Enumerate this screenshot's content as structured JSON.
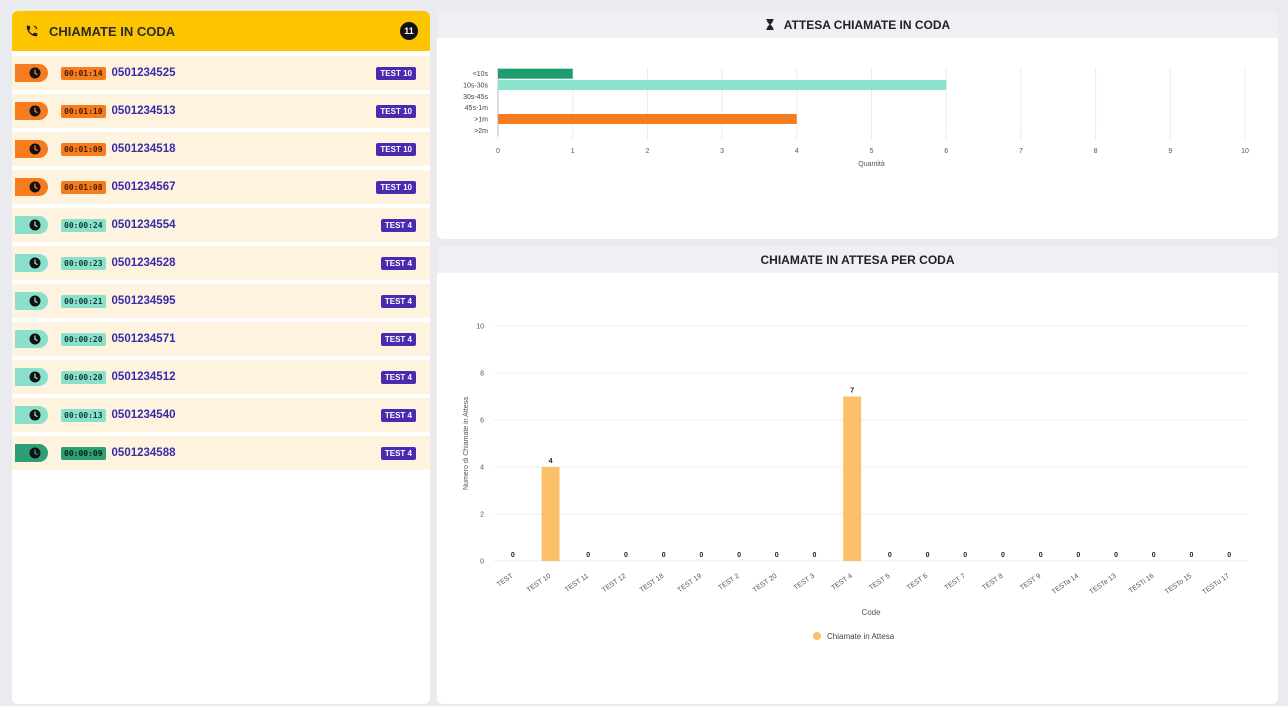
{
  "queue": {
    "title": "CHIAMATE IN CODA",
    "count": "11",
    "items": [
      {
        "timer": "00:01:14",
        "number": "0501234525",
        "tag": "TEST 10",
        "level": "high"
      },
      {
        "timer": "00:01:10",
        "number": "0501234513",
        "tag": "TEST 10",
        "level": "high"
      },
      {
        "timer": "00:01:09",
        "number": "0501234518",
        "tag": "TEST 10",
        "level": "high"
      },
      {
        "timer": "00:01:08",
        "number": "0501234567",
        "tag": "TEST 10",
        "level": "high"
      },
      {
        "timer": "00:00:24",
        "number": "0501234554",
        "tag": "TEST 4",
        "level": "mid"
      },
      {
        "timer": "00:00:23",
        "number": "0501234528",
        "tag": "TEST 4",
        "level": "mid"
      },
      {
        "timer": "00:00:21",
        "number": "0501234595",
        "tag": "TEST 4",
        "level": "mid"
      },
      {
        "timer": "00:00:20",
        "number": "0501234571",
        "tag": "TEST 4",
        "level": "mid"
      },
      {
        "timer": "00:00:20",
        "number": "0501234512",
        "tag": "TEST 4",
        "level": "mid"
      },
      {
        "timer": "00:00:13",
        "number": "0501234540",
        "tag": "TEST 4",
        "level": "mid"
      },
      {
        "timer": "00:00:09",
        "number": "0501234588",
        "tag": "TEST 4",
        "level": "low"
      }
    ]
  },
  "colors": {
    "high": "#f57d1f",
    "mid": "#8be0cc",
    "low": "#2e9e74",
    "accent": "#fdc500",
    "tag": "#4a2bb0",
    "bar_orange": "#fdc06a"
  },
  "icons": {
    "header": "phone-icon",
    "clock": "clock-icon",
    "wait": "hourglass-icon"
  },
  "wait_panel": {
    "title": "ATTESA CHIAMATE IN CODA"
  },
  "queue_panel": {
    "title": "CHIAMATE IN ATTESA PER CODA"
  },
  "chart_data": [
    {
      "type": "bar",
      "orientation": "horizontal",
      "categories": [
        "<10s",
        "10s-30s",
        "30s-45s",
        "45s-1m",
        ">1m",
        ">2m"
      ],
      "values": [
        1,
        6,
        0,
        0,
        4,
        0
      ],
      "bar_colors": [
        "#1e9e6e",
        "#8be3cb",
        "#cccccc",
        "#cccccc",
        "#f57d1f",
        "#cccccc"
      ],
      "xlabel": "Quantità",
      "xlim": [
        0,
        10
      ],
      "xticks": [
        0,
        1,
        2,
        3,
        4,
        5,
        6,
        7,
        8,
        9,
        10
      ],
      "grid": true
    },
    {
      "type": "bar",
      "categories": [
        "TEST",
        "TEST 10",
        "TEST 11",
        "TEST 12",
        "TEST 18",
        "TEST 19",
        "TEST 2",
        "TEST 20",
        "TEST 3",
        "TEST 4",
        "TEST 5",
        "TEST 6",
        "TEST 7",
        "TEST 8",
        "TEST 9",
        "TESTa 14",
        "TESTe 13",
        "TESTi 16",
        "TESTo 15",
        "TESTu 17"
      ],
      "series": [
        {
          "name": "Chiamate in Attesa",
          "values": [
            0,
            4,
            0,
            0,
            0,
            0,
            0,
            0,
            0,
            7,
            0,
            0,
            0,
            0,
            0,
            0,
            0,
            0,
            0,
            0
          ]
        }
      ],
      "xlabel": "Code",
      "ylabel": "Numero di Chiamate in Attesa",
      "ylim": [
        0,
        10
      ],
      "yticks": [
        0,
        2,
        4,
        6,
        8,
        10
      ],
      "legend": "bottom",
      "grid": true
    }
  ]
}
